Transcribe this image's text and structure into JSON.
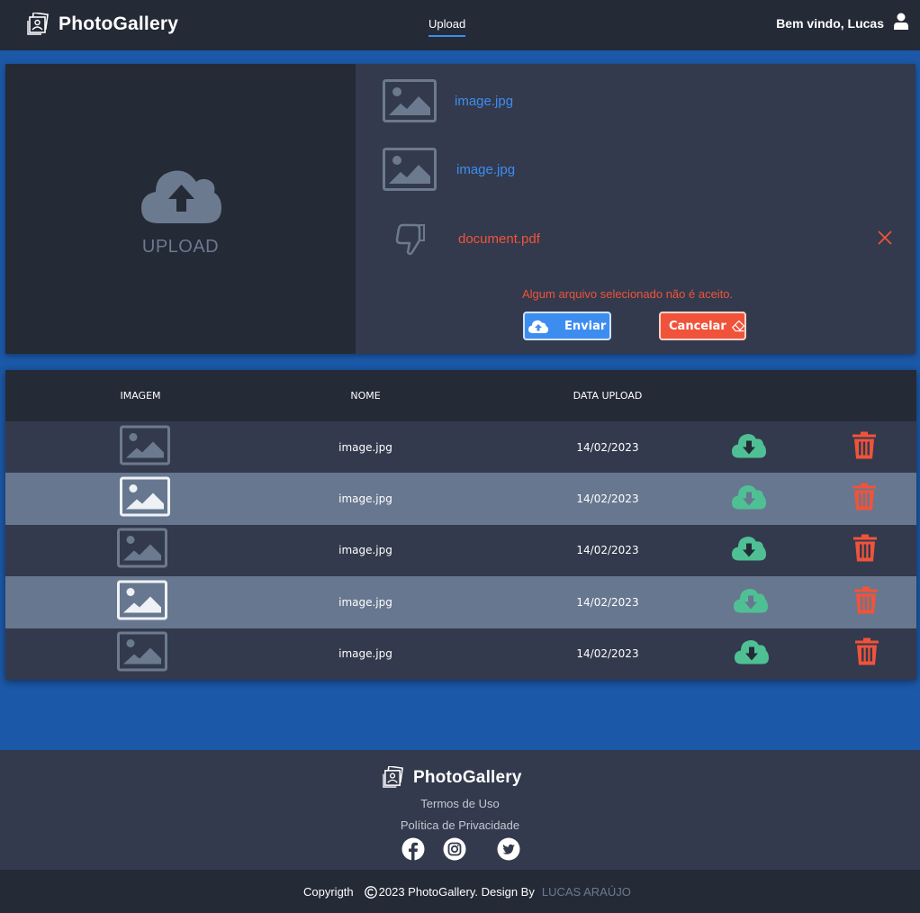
{
  "app": {
    "name": "PhotoGallery",
    "nav_upload": "Upload",
    "welcome": "Bem vindo, Lucas"
  },
  "upload": {
    "dropzone_label": "UPLOAD",
    "files": [
      {
        "name": "image.jpg",
        "status": "accepted",
        "icon": "image-icon"
      },
      {
        "name": "image.jpg",
        "status": "accepted",
        "icon": "image-icon"
      },
      {
        "name": "document.pdf",
        "status": "rejected",
        "icon": "thumbs-down-icon"
      }
    ],
    "error_message": "Algum arquivo selecionado não é aceito.",
    "send_label": "Enviar",
    "cancel_label": "Cancelar"
  },
  "table": {
    "headers": [
      "IMAGEM",
      "NOME",
      "DATA UPLOAD"
    ],
    "rows": [
      {
        "name": "image.jpg",
        "date": "14/02/2023"
      },
      {
        "name": "image.jpg",
        "date": "14/02/2023"
      },
      {
        "name": "image.jpg",
        "date": "14/02/2023"
      },
      {
        "name": "image.jpg",
        "date": "14/02/2023"
      },
      {
        "name": "image.jpg",
        "date": "14/02/2023"
      }
    ]
  },
  "footer": {
    "brand": "PhotoGallery",
    "terms": "Termos de Uso",
    "privacy": "Política de Privacidade",
    "social": [
      "facebook-icon",
      "instagram-icon",
      "twitter-icon"
    ],
    "copyright_prefix": "Copyrigth",
    "copyright_text": "2023 PhotoGallery. Design By",
    "author": "LUCAS ARAÚJO"
  },
  "colors": {
    "page_bg": "#1b58a8",
    "header_bg": "#242a36",
    "panel_bg": "#333a4d",
    "row_light": "#67778f",
    "accent_blue": "#3d8df0",
    "danger_red": "#f0533a",
    "download_green": "#4fc094",
    "muted": "#6c7a8f"
  }
}
